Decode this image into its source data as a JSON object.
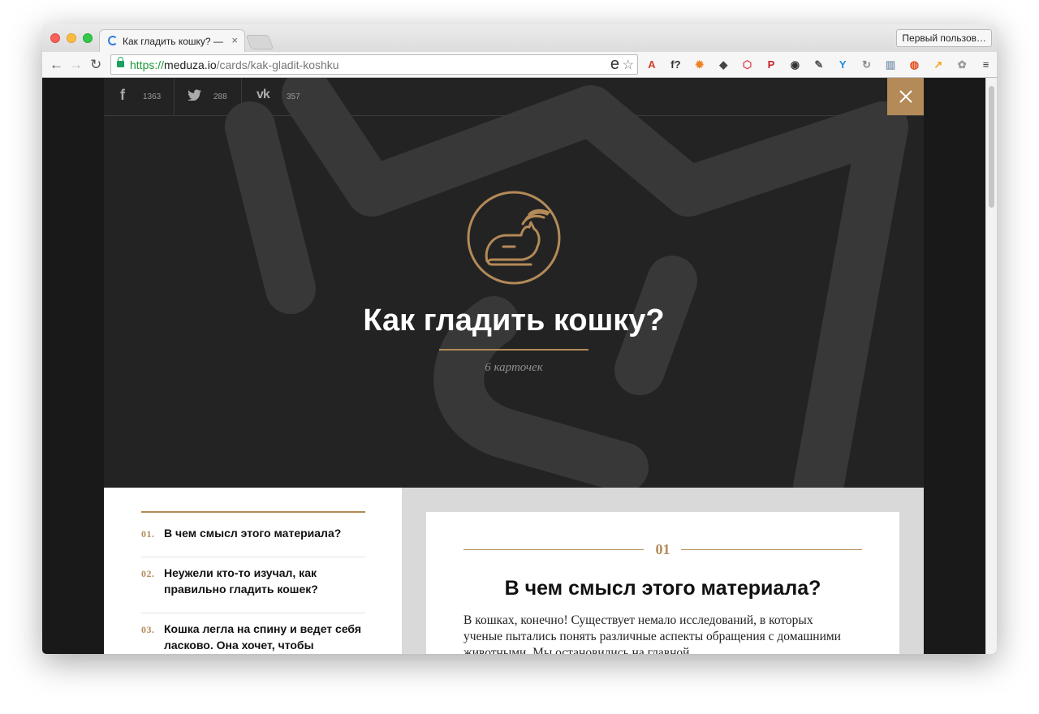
{
  "browser": {
    "tab_title": "Как гладить кошку? — Me",
    "tab_close": "×",
    "profile_button": "Первый пользов…",
    "url_scheme": "https://",
    "url_host": "meduza.io",
    "url_path": "/cards/kak-gladit-koshku",
    "omnibox_e": "e",
    "extensions": [
      "adblock-icon",
      "ffont-icon",
      "flame-icon",
      "evernote-icon",
      "pocket-icon",
      "pinterest-icon",
      "lens-icon",
      "eyedropper-icon",
      "y-icon",
      "loop-icon",
      "book-icon",
      "rss-2m-icon",
      "chart-icon",
      "paw-icon",
      "menu-icon"
    ],
    "ext_glyphs": [
      "A",
      "f?",
      "✹",
      "◆",
      "⬡",
      "P",
      "◉",
      "✎",
      "Y",
      "↻",
      "▥",
      "◍",
      "↗",
      "✿",
      "≡"
    ],
    "ext_colors": [
      "#d23b2a",
      "#333333",
      "#f08020",
      "#444444",
      "#dd3d4b",
      "#cb2027",
      "#333333",
      "#555555",
      "#1a8be0",
      "#888888",
      "#8aa0b4",
      "#e24a1a",
      "#f5a623",
      "#999999",
      "#333333"
    ]
  },
  "share": {
    "facebook_count": "1363",
    "twitter_count": "288",
    "vk_count": "357",
    "facebook_glyph": "f",
    "twitter_glyph": "🐦",
    "vk_glyph": "vk"
  },
  "hero": {
    "title": "Как гладить кошку?",
    "subtitle": "6 карточек"
  },
  "toc": {
    "items": [
      {
        "num": "01.",
        "text": "В чем смысл этого материала?"
      },
      {
        "num": "02.",
        "text": "Неужели кто-то изучал, как правильно гладить кошек?"
      },
      {
        "num": "03.",
        "text": "Кошка легла на спину и ведет себя ласково. Она хочет, чтобы"
      }
    ]
  },
  "card": {
    "num": "01",
    "title": "В чем смысл этого материала?",
    "body": "В кошках, конечно! Существует немало исследований, в которых ученые пытались понять различные аспекты обращения с домашними животными. Мы остановились на главной"
  },
  "colors": {
    "accent": "#b38a58",
    "hero_bg": "#232323",
    "page_bg": "#191919"
  }
}
